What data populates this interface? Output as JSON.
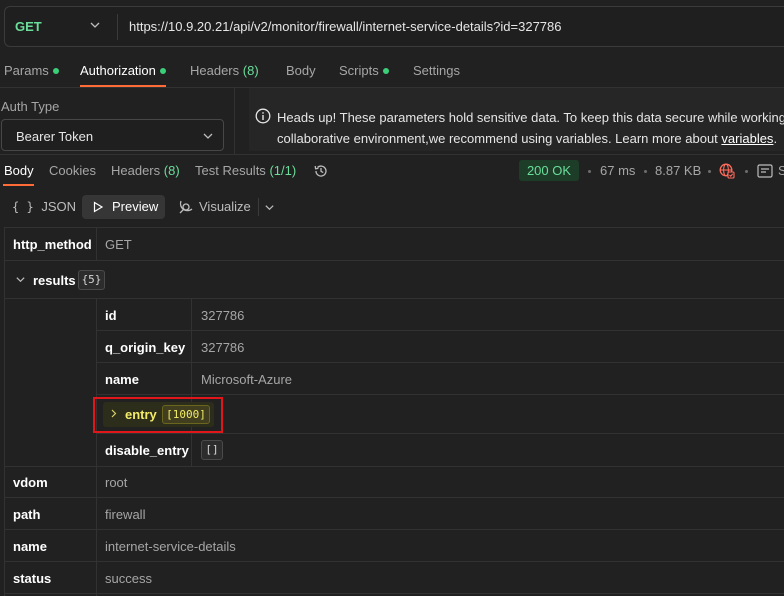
{
  "request": {
    "method": "GET",
    "url": "https://10.9.20.21/api/v2/monitor/firewall/internet-service-details?id=327786"
  },
  "request_tabs": [
    {
      "label": "Params",
      "dot": true
    },
    {
      "label": "Authorization",
      "dot": true,
      "active": true
    },
    {
      "label": "Headers",
      "count": "(8)"
    },
    {
      "label": "Body"
    },
    {
      "label": "Scripts",
      "dot": true
    },
    {
      "label": "Settings"
    }
  ],
  "auth": {
    "label": "Auth Type",
    "type": "Bearer Token",
    "notice_line1": "Heads up! These parameters hold sensitive data. To keep this data secure while working i",
    "notice_line2_prefix": "collaborative environment,we recommend using variables. Learn more about ",
    "notice_link": "variables",
    "notice_suffix": "."
  },
  "response_tabs": [
    {
      "label": "Body",
      "active": true
    },
    {
      "label": "Cookies"
    },
    {
      "label": "Headers",
      "count": "(8)"
    },
    {
      "label": "Test Results",
      "count": "(1/1)"
    }
  ],
  "response_meta": {
    "status": "200 OK",
    "time": "67 ms",
    "size": "8.87 KB",
    "save_partial": "S"
  },
  "view_modes": {
    "json": "JSON",
    "json_icon": "{ }",
    "preview": "Preview",
    "visualize": "Visualize"
  },
  "table": {
    "http_method_key": "http_method",
    "http_method_val": "GET",
    "results_key": "results",
    "results_badge": "{5}",
    "results": {
      "id_key": "id",
      "id_val": "327786",
      "origin_key": "q_origin_key",
      "origin_val": "327786",
      "name_key": "name",
      "name_val": "Microsoft-Azure",
      "entry_key": "entry",
      "entry_badge": "[1000]",
      "disable_key": "disable_entry",
      "disable_badge": "[]"
    },
    "vdom_key": "vdom",
    "vdom_val": "root",
    "path_key": "path",
    "path_val": "firewall",
    "name_key": "name",
    "name_val": "internet-service-details",
    "status_key": "status",
    "status_val": "success"
  },
  "colors": {
    "accent": "#ff6c37",
    "success": "#6bdd9a",
    "entry_highlight": "#f2ec6a",
    "annotation_box": "#e0161b"
  }
}
